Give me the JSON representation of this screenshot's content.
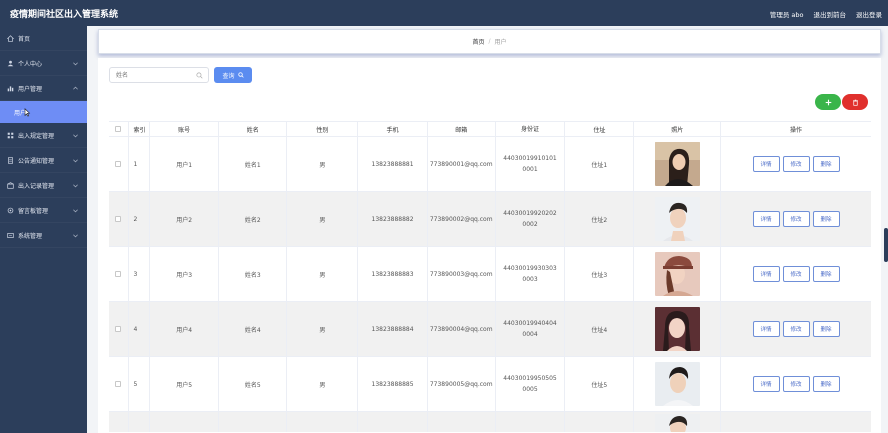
{
  "app_title": "疫情期间社区出入管理系统",
  "header": {
    "admin_label": "管理员 abo",
    "backend_link": "退出到前台",
    "logout_link": "退出登录"
  },
  "sidebar": {
    "home": "首页",
    "items": [
      {
        "label": "个人中心"
      },
      {
        "label": "用户管理"
      },
      {
        "label": "出入规定管理"
      },
      {
        "label": "公告通知管理"
      },
      {
        "label": "出入记录管理"
      },
      {
        "label": "留言板管理"
      },
      {
        "label": "系统管理"
      }
    ],
    "submenu_user": "用户"
  },
  "breadcrumb": {
    "home": "首页",
    "sep": "/",
    "current": "用户"
  },
  "search": {
    "placeholder": "姓名",
    "button": "查询"
  },
  "colors": {
    "topbar": "#2c3e5b",
    "accent": "#5b8cf0",
    "add": "#3ab54a",
    "delete": "#e0302d"
  },
  "table": {
    "headers": [
      "索引",
      "账号",
      "姓名",
      "性别",
      "手机",
      "邮箱",
      "身份证",
      "住址",
      "照片",
      "操作"
    ],
    "rows": [
      {
        "idx": "1",
        "account": "用户1",
        "name": "姓名1",
        "gender": "男",
        "phone": "13823888881",
        "email": "773890001@qq.com",
        "idcard": "440300199101010001",
        "address": "住址1"
      },
      {
        "idx": "2",
        "account": "用户2",
        "name": "姓名2",
        "gender": "男",
        "phone": "13823888882",
        "email": "773890002@qq.com",
        "idcard": "440300199202020002",
        "address": "住址2"
      },
      {
        "idx": "3",
        "account": "用户3",
        "name": "姓名3",
        "gender": "男",
        "phone": "13823888883",
        "email": "773890003@qq.com",
        "idcard": "440300199303030003",
        "address": "住址3"
      },
      {
        "idx": "4",
        "account": "用户4",
        "name": "姓名4",
        "gender": "男",
        "phone": "13823888884",
        "email": "773890004@qq.com",
        "idcard": "440300199404040004",
        "address": "住址4"
      },
      {
        "idx": "5",
        "account": "用户5",
        "name": "姓名5",
        "gender": "男",
        "phone": "13823888885",
        "email": "773890005@qq.com",
        "idcard": "440300199505050005",
        "address": "住址5"
      }
    ],
    "ops": {
      "detail": "详情",
      "edit": "修改",
      "delete": "删除"
    }
  }
}
